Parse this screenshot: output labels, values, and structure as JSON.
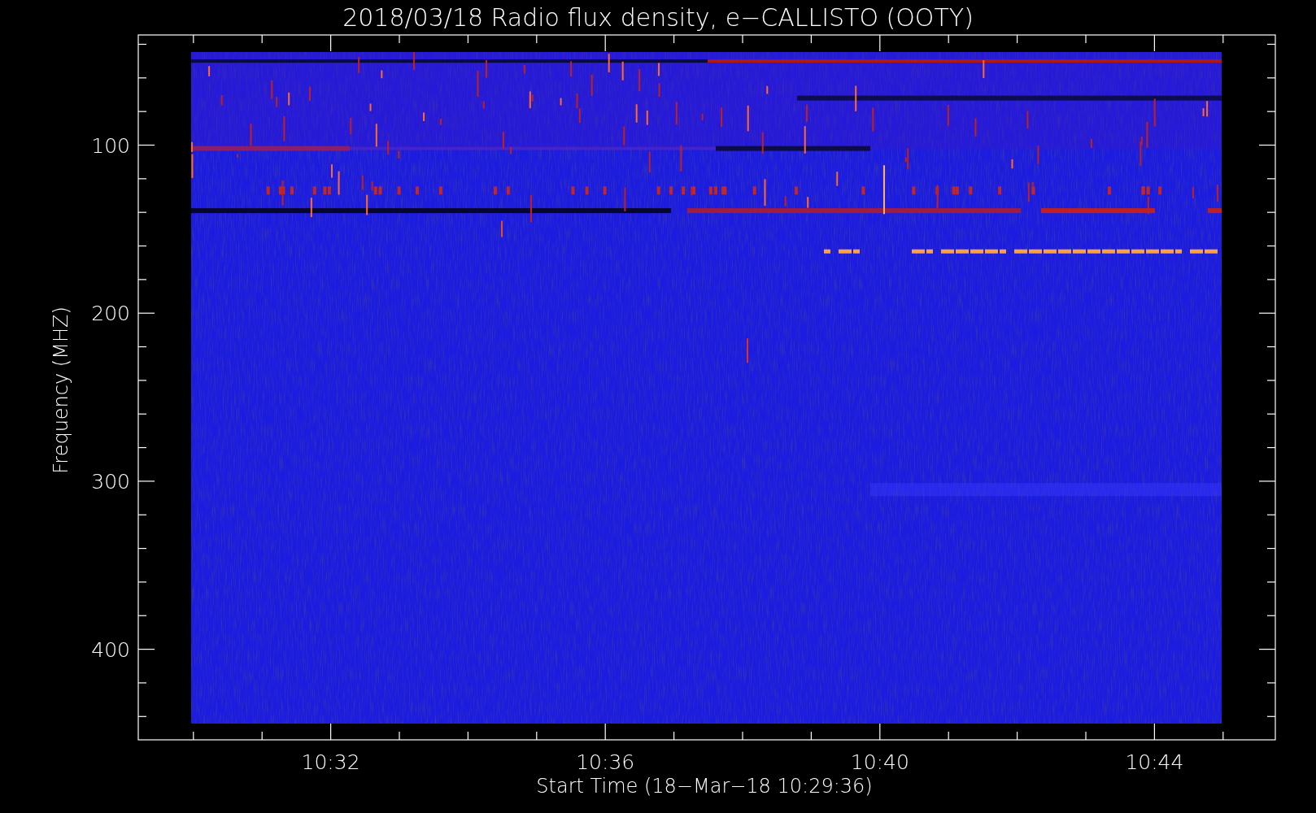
{
  "plot": {
    "title": "2018/03/18  Radio flux density, e−CALLISTO (OOTY)",
    "xlabel": "Start Time (18−Mar−18 10:29:36)",
    "ylabel": "Frequency (MHZ)",
    "x_tick_labels": [
      "10:32",
      "10:36",
      "10:40",
      "10:44"
    ],
    "y_tick_labels": [
      "100",
      "200",
      "300",
      "400"
    ]
  }
}
